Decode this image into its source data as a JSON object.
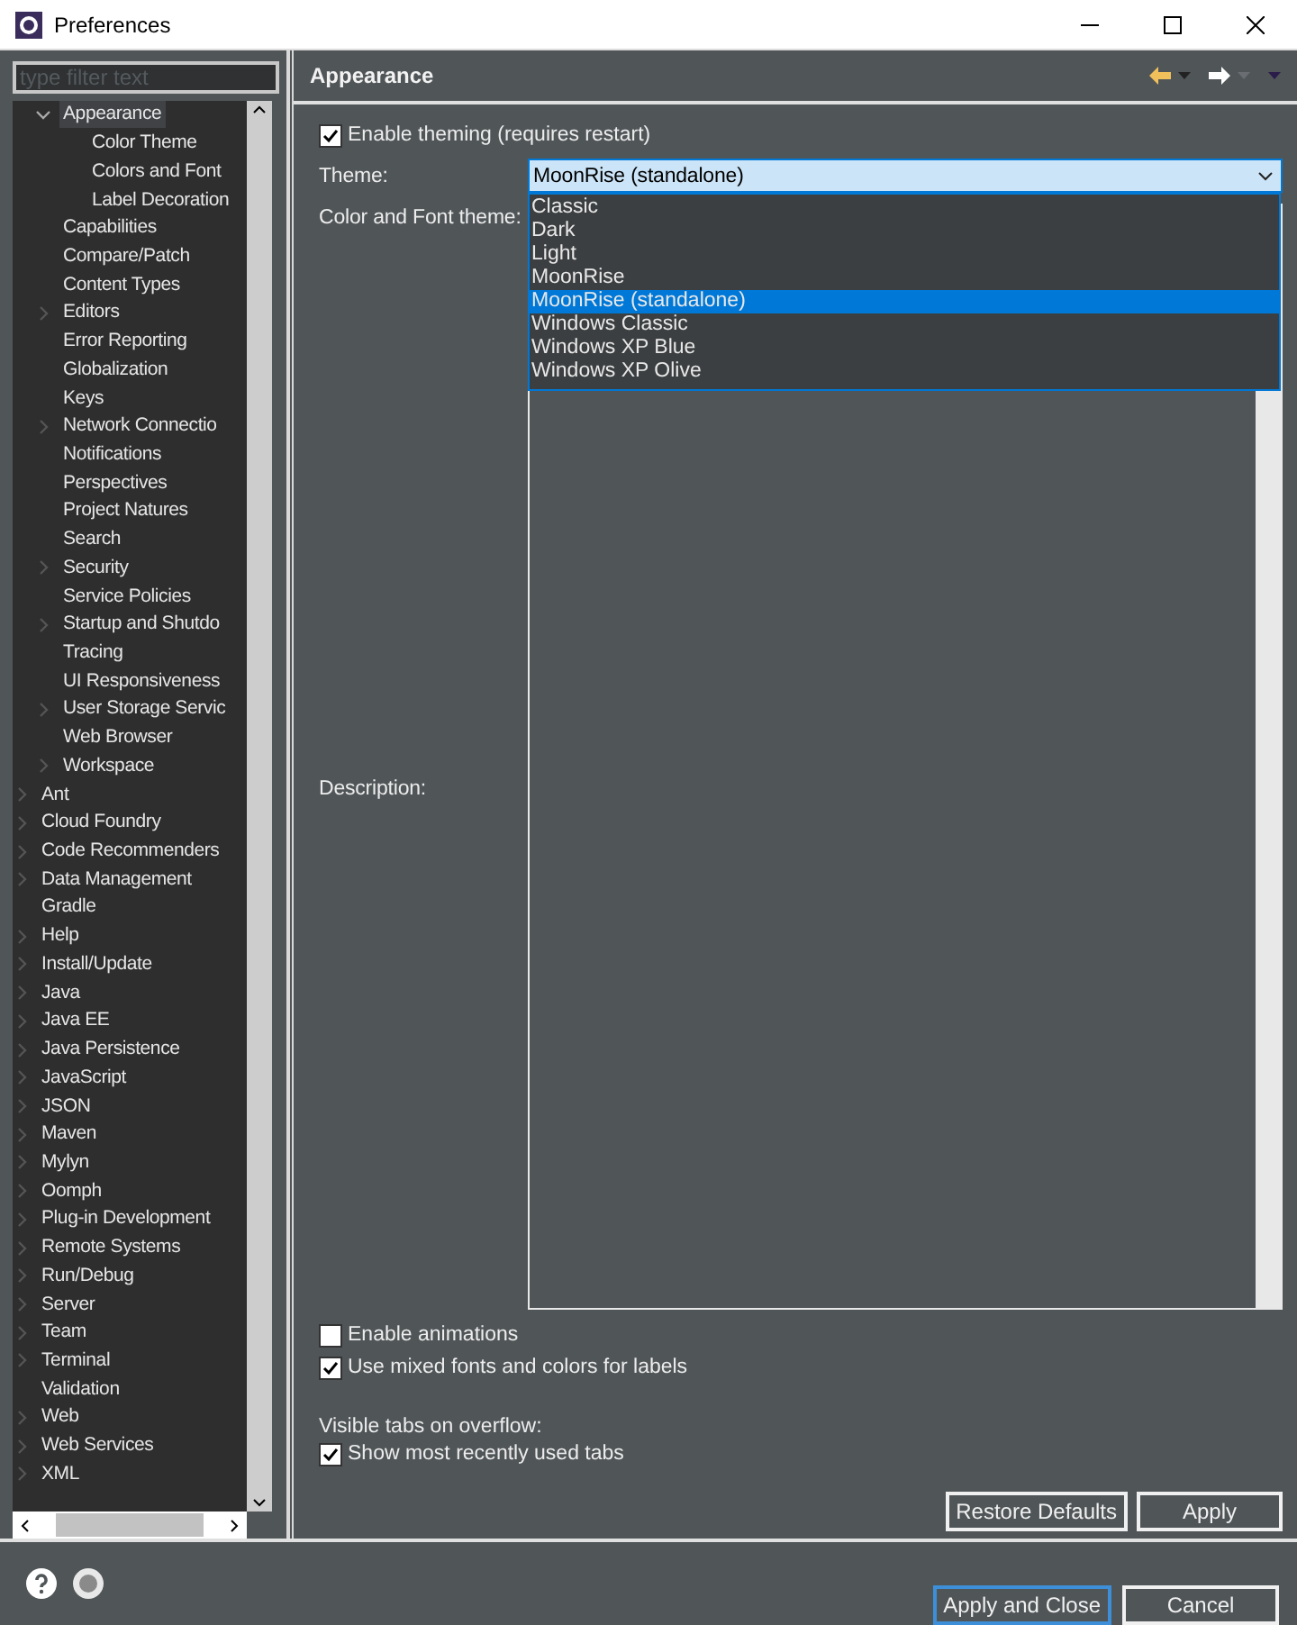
{
  "window": {
    "title": "Preferences"
  },
  "filter": {
    "placeholder": "type filter text"
  },
  "tree": {
    "items": [
      {
        "children": [
          {
            "label": "Appearance",
            "expanded": true,
            "selected": true,
            "children": [
              {
                "label": "Color Theme",
                "selected": false
              },
              {
                "label": "Colors and Font",
                "selected": false
              },
              {
                "label": "Label Decoration",
                "selected": false
              }
            ]
          },
          {
            "label": "Capabilities",
            "selected": false
          },
          {
            "label": "Compare/Patch",
            "selected": false
          },
          {
            "label": "Content Types",
            "selected": false
          },
          {
            "label": "Editors",
            "expanded": false,
            "selected": false
          },
          {
            "label": "Error Reporting",
            "selected": false
          },
          {
            "label": "Globalization",
            "selected": false
          },
          {
            "label": "Keys",
            "selected": false
          },
          {
            "label": "Network Connectio",
            "expanded": false,
            "selected": false
          },
          {
            "label": "Notifications",
            "selected": false
          },
          {
            "label": "Perspectives",
            "selected": false
          },
          {
            "label": "Project Natures",
            "selected": false
          },
          {
            "label": "Search",
            "selected": false
          },
          {
            "label": "Security",
            "expanded": false,
            "selected": false
          },
          {
            "label": "Service Policies",
            "selected": false
          },
          {
            "label": "Startup and Shutdo",
            "expanded": false,
            "selected": false
          },
          {
            "label": "Tracing",
            "selected": false
          },
          {
            "label": "UI Responsiveness",
            "selected": false
          },
          {
            "label": "User Storage Servic",
            "expanded": false,
            "selected": false
          },
          {
            "label": "Web Browser",
            "selected": false
          },
          {
            "label": "Workspace",
            "expanded": false,
            "selected": false
          }
        ]
      },
      {
        "label": "Ant",
        "expanded": false,
        "selected": false
      },
      {
        "label": "Cloud Foundry",
        "expanded": false,
        "selected": false
      },
      {
        "label": "Code Recommenders",
        "expanded": false,
        "selected": false
      },
      {
        "label": "Data Management",
        "expanded": false,
        "selected": false
      },
      {
        "label": "Gradle",
        "selected": false
      },
      {
        "label": "Help",
        "expanded": false,
        "selected": false
      },
      {
        "label": "Install/Update",
        "expanded": false,
        "selected": false
      },
      {
        "label": "Java",
        "expanded": false,
        "selected": false
      },
      {
        "label": "Java EE",
        "expanded": false,
        "selected": false
      },
      {
        "label": "Java Persistence",
        "expanded": false,
        "selected": false
      },
      {
        "label": "JavaScript",
        "expanded": false,
        "selected": false
      },
      {
        "label": "JSON",
        "expanded": false,
        "selected": false
      },
      {
        "label": "Maven",
        "expanded": false,
        "selected": false
      },
      {
        "label": "Mylyn",
        "expanded": false,
        "selected": false
      },
      {
        "label": "Oomph",
        "expanded": false,
        "selected": false
      },
      {
        "label": "Plug-in Development",
        "expanded": false,
        "selected": false
      },
      {
        "label": "Remote Systems",
        "expanded": false,
        "selected": false
      },
      {
        "label": "Run/Debug",
        "expanded": false,
        "selected": false
      },
      {
        "label": "Server",
        "expanded": false,
        "selected": false
      },
      {
        "label": "Team",
        "expanded": false,
        "selected": false
      },
      {
        "label": "Terminal",
        "expanded": false,
        "selected": false
      },
      {
        "label": "Validation",
        "selected": false
      },
      {
        "label": "Web",
        "expanded": false,
        "selected": false
      },
      {
        "label": "Web Services",
        "expanded": false,
        "selected": false
      },
      {
        "label": "XML",
        "expanded": false,
        "selected": false
      }
    ]
  },
  "page": {
    "title": "Appearance",
    "enable_theming": {
      "label": "Enable theming (requires restart)",
      "checked": true
    },
    "theme": {
      "label": "Theme:",
      "value": "MoonRise (standalone)",
      "expanded": true,
      "options": [
        {
          "label": "Classic",
          "selected": false
        },
        {
          "label": "Dark",
          "selected": false
        },
        {
          "label": "Light",
          "selected": false
        },
        {
          "label": "MoonRise",
          "selected": false
        },
        {
          "label": "MoonRise (standalone)",
          "selected": true
        },
        {
          "label": "Windows Classic",
          "selected": false
        },
        {
          "label": "Windows XP Blue",
          "selected": false
        },
        {
          "label": "Windows XP Olive",
          "selected": false
        }
      ]
    },
    "color_font_theme": {
      "label": "Color and Font theme:"
    },
    "description": {
      "label": "Description:"
    },
    "options": [
      {
        "label": "Enable animations",
        "checked": false
      },
      {
        "label": "Use mixed fonts and colors for labels",
        "checked": true
      }
    ],
    "tabs_overflow": {
      "label": "Visible tabs on overflow:",
      "option": {
        "label": "Show most recently used tabs",
        "checked": true
      }
    },
    "buttons": [
      "Restore Defaults",
      "Apply"
    ]
  },
  "footer": {
    "buttons": [
      {
        "label": "Apply and Close",
        "default": true
      },
      {
        "label": "Cancel",
        "default": false
      }
    ]
  }
}
